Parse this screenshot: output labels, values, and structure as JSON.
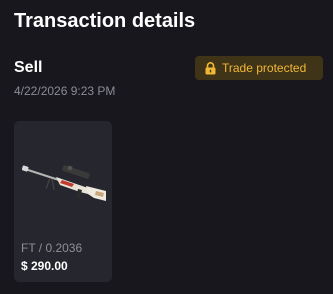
{
  "header": {
    "title": "Transaction details"
  },
  "transaction": {
    "type": "Sell",
    "date": "4/22/2026 9:23 PM",
    "badge": {
      "icon": "lock-icon",
      "label": "Trade protected",
      "text_color": "#f2b735",
      "background": "#3f3418"
    }
  },
  "item": {
    "image_icon": "sniper-rifle-icon",
    "wear": "FT / 0.2036",
    "price": "$ 290.00"
  },
  "colors": {
    "background": "#17171d",
    "card": "#26262e",
    "muted_text": "#8b8b96"
  }
}
